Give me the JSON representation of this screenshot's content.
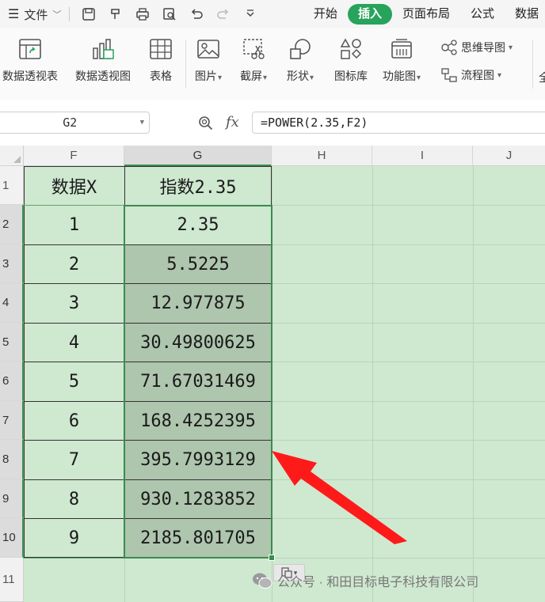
{
  "menubar": {
    "file_label": "文件",
    "tabs": [
      {
        "label": "开始",
        "active": false
      },
      {
        "label": "插入",
        "active": true
      },
      {
        "label": "页面布局",
        "active": false
      },
      {
        "label": "公式",
        "active": false
      },
      {
        "label": "数据",
        "active": false
      }
    ]
  },
  "ribbon": {
    "pivot_table": "数据透视表",
    "pivot_chart": "数据透视图",
    "table": "表格",
    "picture": "图片",
    "screenshot": "截屏",
    "shape": "形状",
    "icon_library": "图标库",
    "function_chart": "功能图",
    "mind_map": "思维导图",
    "flowchart": "流程图",
    "cutoff": "全"
  },
  "formula_bar": {
    "cell_ref": "G2",
    "fx": "fx",
    "formula": "=POWER(2.35,F2)"
  },
  "sheet": {
    "columns": [
      "F",
      "G",
      "H",
      "I",
      "J"
    ],
    "rows": [
      "1",
      "2",
      "3",
      "4",
      "5",
      "6",
      "7",
      "8",
      "9",
      "10",
      "11"
    ],
    "header": {
      "F": "数据X",
      "G": "指数2.35"
    },
    "data": [
      {
        "x": "1",
        "y": "2.35"
      },
      {
        "x": "2",
        "y": "5.5225"
      },
      {
        "x": "3",
        "y": "12.977875"
      },
      {
        "x": "4",
        "y": "30.49800625"
      },
      {
        "x": "5",
        "y": "71.67031469"
      },
      {
        "x": "6",
        "y": "168.4252395"
      },
      {
        "x": "7",
        "y": "395.7993129"
      },
      {
        "x": "8",
        "y": "930.1283852"
      },
      {
        "x": "9",
        "y": "2185.801705"
      }
    ]
  },
  "watermark": "公众号 · 和田目标电子科技有限公司",
  "colors": {
    "accent": "#27a35c",
    "sheet_bg": "#cfe8d0",
    "selection": "#3a8b4e",
    "arrow": "#ff1a1a"
  }
}
